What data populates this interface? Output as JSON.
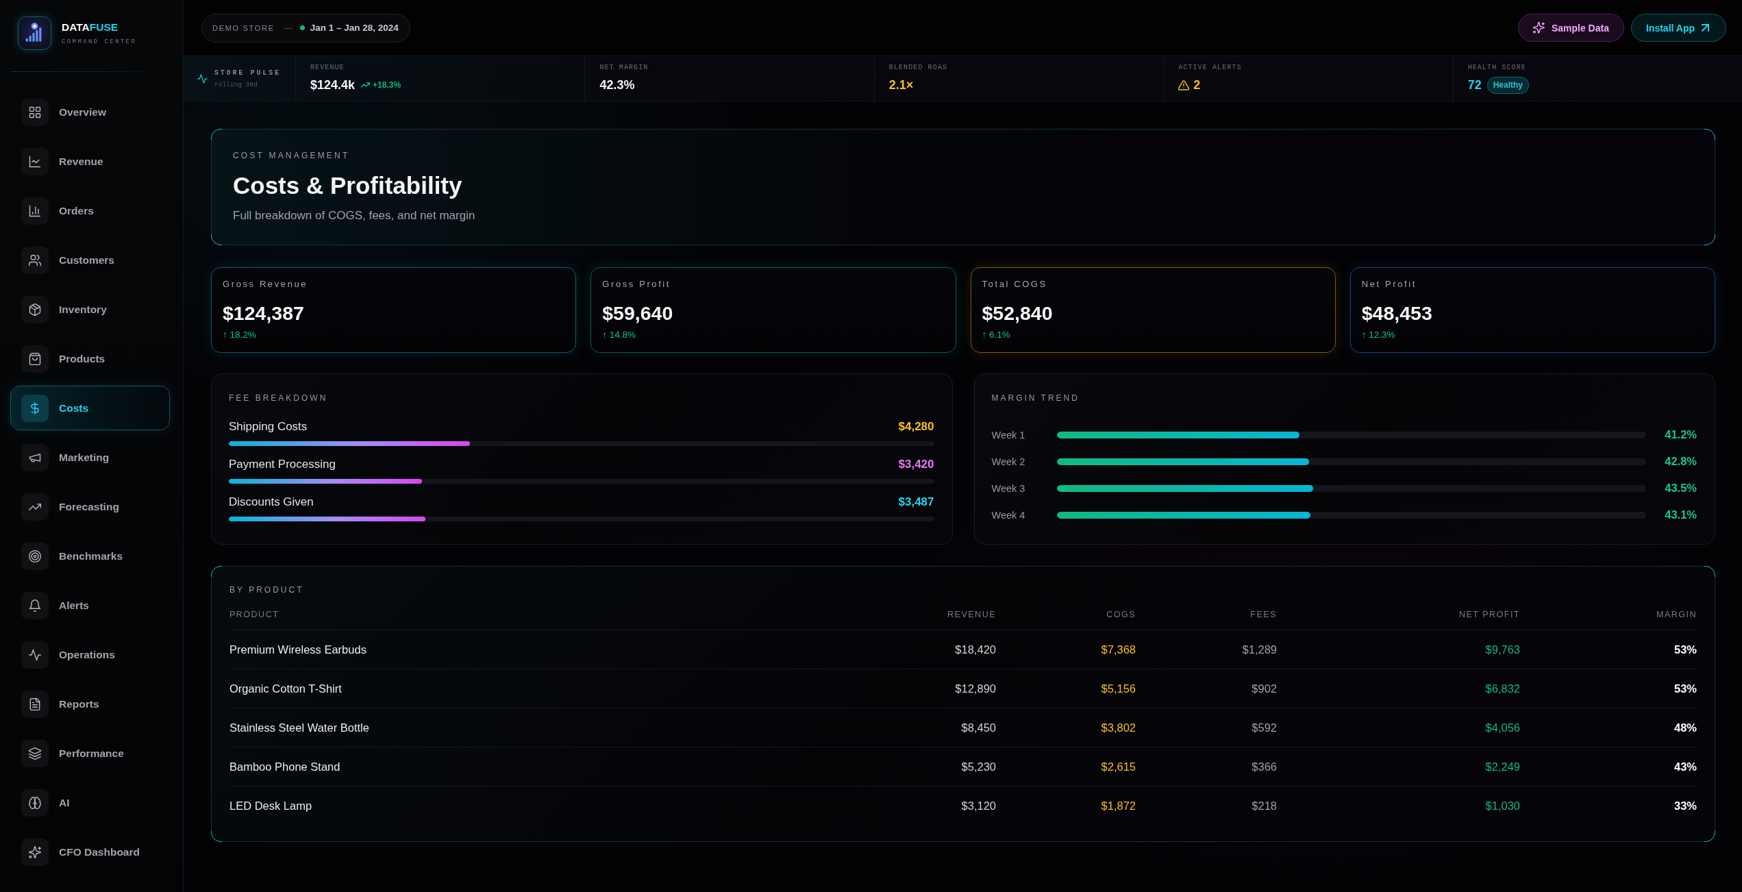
{
  "sidebar": {
    "brand": {
      "name": "DATA",
      "name_accent": "FUSE",
      "tagline": "COMMAND CENTER"
    },
    "items": [
      {
        "label": "Overview",
        "selected": false
      },
      {
        "label": "Revenue",
        "selected": false
      },
      {
        "label": "Orders",
        "selected": false
      },
      {
        "label": "Customers",
        "selected": false
      },
      {
        "label": "Inventory",
        "selected": false
      },
      {
        "label": "Products",
        "selected": false
      },
      {
        "label": "Costs",
        "selected": true
      },
      {
        "label": "Marketing",
        "selected": false
      },
      {
        "label": "Forecasting",
        "selected": false
      },
      {
        "label": "Benchmarks",
        "selected": false
      },
      {
        "label": "Alerts",
        "selected": false
      },
      {
        "label": "Operations",
        "selected": false
      },
      {
        "label": "Reports",
        "selected": false
      },
      {
        "label": "Performance",
        "selected": false
      },
      {
        "label": "AI",
        "selected": false
      },
      {
        "label": "CFO Dashboard",
        "selected": false
      }
    ]
  },
  "topbar": {
    "store": "DEMO STORE",
    "separator": "—",
    "date_range": "Jan 1 – Jan 28, 2024",
    "buttons": [
      {
        "kind": "sample",
        "label": "Sample Data"
      },
      {
        "kind": "install",
        "label": "Install App"
      }
    ]
  },
  "pulse": {
    "title": "STORE PULSE",
    "subtitle": "rolling 30d",
    "metrics": [
      {
        "kind": "trend",
        "label": "REVENUE",
        "value": "$124.4k",
        "delta": "+18.3%",
        "color": "#f4f4f5"
      },
      {
        "kind": "plain",
        "label": "NET MARGIN",
        "value": "42.3%",
        "color": "#f4f4f5"
      },
      {
        "kind": "plain",
        "label": "BLENDED ROAS",
        "value": "2.1×",
        "color": "#fbbf24"
      },
      {
        "kind": "alert",
        "label": "ACTIVE ALERTS",
        "value": "2",
        "color": "#fbbf24"
      },
      {
        "kind": "score",
        "label": "HEALTH SCORE",
        "value": "72",
        "badge": "Healthy",
        "color": "#22d3ee"
      }
    ]
  },
  "header": {
    "eyebrow": "COST MANAGEMENT",
    "title": "Costs & Profitability",
    "subtitle": "Full breakdown of COGS, fees, and net margin"
  },
  "kpis": [
    {
      "label": "Gross Revenue",
      "value": "$124,387",
      "delta": "↑ 18.2%",
      "color": "#0f5d66"
    },
    {
      "label": "Gross Profit",
      "value": "$59,640",
      "delta": "↑ 14.8%",
      "color": "#0e5c48"
    },
    {
      "label": "Total COGS",
      "value": "$52,840",
      "delta": "↑ 6.1%",
      "color": "#7a5a0e"
    },
    {
      "label": "Net Profit",
      "value": "$48,453",
      "delta": "↑ 12.3%",
      "color": "#1f4070"
    }
  ],
  "fee_breakdown": {
    "title": "FEE BREAKDOWN",
    "items": [
      {
        "label": "Shipping Costs",
        "value": "$4,280",
        "level": 0.342,
        "color": "#fbbf24"
      },
      {
        "label": "Payment Processing",
        "value": "$3,420",
        "level": 0.274,
        "color": "#e879f9"
      },
      {
        "label": "Discounts Given",
        "value": "$3,487",
        "level": 0.279,
        "color": "#22d3ee"
      }
    ]
  },
  "margin_trend": {
    "title": "MARGIN TREND",
    "items": [
      {
        "label": "Week 1",
        "value": "41.2%",
        "level": 0.412
      },
      {
        "label": "Week 2",
        "value": "42.8%",
        "level": 0.428
      },
      {
        "label": "Week 3",
        "value": "43.5%",
        "level": 0.435
      },
      {
        "label": "Week 4",
        "value": "43.1%",
        "level": 0.431
      }
    ]
  },
  "by_product": {
    "title": "BY PRODUCT",
    "columns": [
      "PRODUCT",
      "REVENUE",
      "COGS",
      "FEES",
      "NET PROFIT",
      "MARGIN"
    ],
    "rows": [
      {
        "cells": [
          "Premium Wireless Earbuds",
          "$18,420",
          "$7,368",
          "$1,289",
          "$9,763",
          "53%"
        ]
      },
      {
        "cells": [
          "Organic Cotton T-Shirt",
          "$12,890",
          "$5,156",
          "$902",
          "$6,832",
          "53%"
        ]
      },
      {
        "cells": [
          "Stainless Steel Water Bottle",
          "$8,450",
          "$3,802",
          "$592",
          "$4,056",
          "48%"
        ]
      },
      {
        "cells": [
          "Bamboo Phone Stand",
          "$5,230",
          "$2,615",
          "$366",
          "$2,249",
          "43%"
        ]
      },
      {
        "cells": [
          "LED Desk Lamp",
          "$3,120",
          "$1,872",
          "$218",
          "$1,030",
          "33%"
        ]
      }
    ]
  }
}
